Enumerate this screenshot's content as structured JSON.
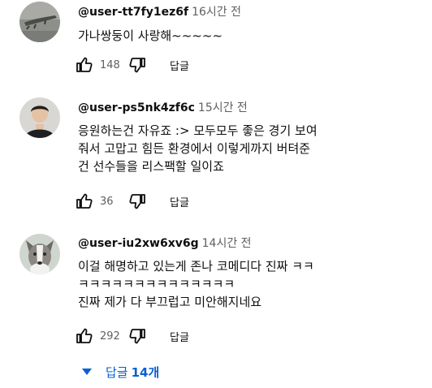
{
  "comments": [
    {
      "author": "@user-tt7fy1ez6f",
      "time": "16시간 전",
      "text": "가나쌍둥이 사랑해~~~~~",
      "likes": "148",
      "reply_label": "답글"
    },
    {
      "author": "@user-ps5nk4zf6c",
      "time": "15시간 전",
      "text": "응원하는건 자유죠 :> 모두모두 좋은 경기 보여\n줘서 고맙고 힘든 환경에서 이렇게까지 버텨준\n건 선수들을 리스팩할 일이죠",
      "likes": "36",
      "reply_label": "답글"
    },
    {
      "author": "@user-iu2xw6xv6g",
      "time": "14시간 전",
      "text": "이걸 해명하고 있는게 존나 코메디다 진짜 ㅋㅋ\nㅋㅋㅋㅋㅋㅋㅋㅋㅋㅋㅋㅋㅋㅋ\n진짜 제가 다 부끄럽고 미안해지네요",
      "likes": "292",
      "reply_label": "답글"
    }
  ],
  "replies_toggle": {
    "label": "답글",
    "count": "14개",
    "icon": "caret-down-icon"
  },
  "colors": {
    "link_blue": "#065fd4",
    "meta_gray": "#606060",
    "text": "#0f0f0f"
  }
}
